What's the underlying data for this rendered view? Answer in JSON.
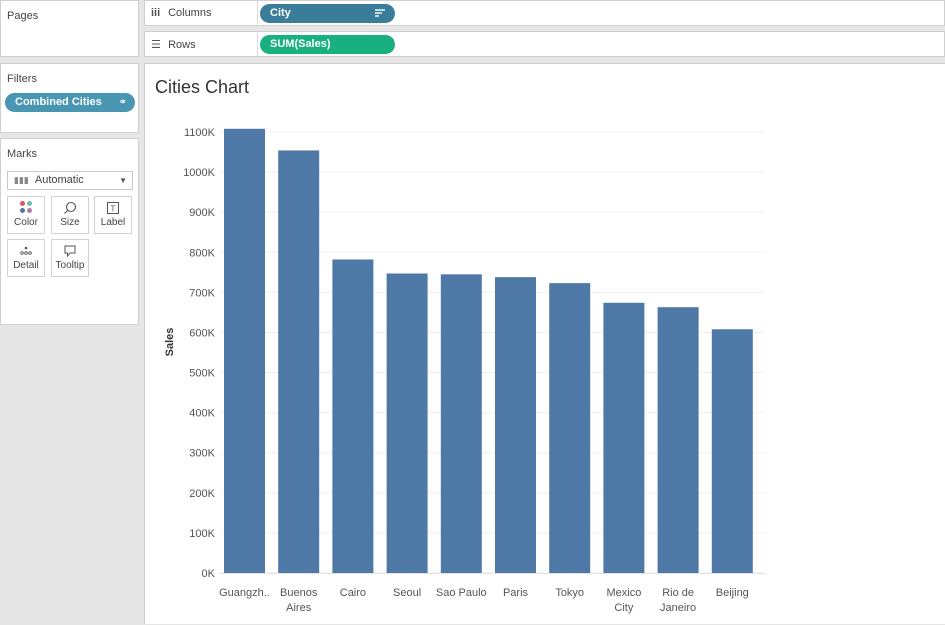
{
  "pages": {
    "title": "Pages"
  },
  "filters": {
    "title": "Filters",
    "pill": "Combined Cities",
    "pill_icon": "link-icon"
  },
  "columns": {
    "label": "Columns",
    "pill": "City",
    "icon": "columns-icon"
  },
  "rows": {
    "label": "Rows",
    "pill": "SUM(Sales)",
    "icon": "rows-icon"
  },
  "marks": {
    "title": "Marks",
    "mark_type": "Automatic",
    "buttons": {
      "color": "Color",
      "size": "Size",
      "label": "Label",
      "detail": "Detail",
      "tooltip": "Tooltip"
    }
  },
  "colors": {
    "bar": "#4e79a7",
    "columns_pill": "#3a7d9a",
    "rows_pill": "#18b07f",
    "filter_pill": "#4996b2"
  },
  "view": {
    "title": "Cities Chart"
  },
  "chart_data": {
    "type": "bar",
    "title": "Cities Chart",
    "xlabel": "",
    "ylabel": "Sales",
    "categories": [
      [
        "Guangzh.."
      ],
      [
        "Buenos",
        "Aires"
      ],
      [
        "Cairo"
      ],
      [
        "Seoul"
      ],
      [
        "Sao Paulo"
      ],
      [
        "Paris"
      ],
      [
        "Tokyo"
      ],
      [
        "Mexico",
        "City"
      ],
      [
        "Rio de",
        "Janeiro"
      ],
      [
        "Beijing"
      ]
    ],
    "values": [
      1108000,
      1054000,
      782000,
      747000,
      745000,
      738000,
      723000,
      674000,
      663000,
      608000
    ],
    "ylim": [
      0,
      1100000
    ],
    "yticks": [
      "0K",
      "100K",
      "200K",
      "300K",
      "400K",
      "500K",
      "600K",
      "700K",
      "800K",
      "900K",
      "1000K",
      "1100K"
    ],
    "grid": true
  }
}
